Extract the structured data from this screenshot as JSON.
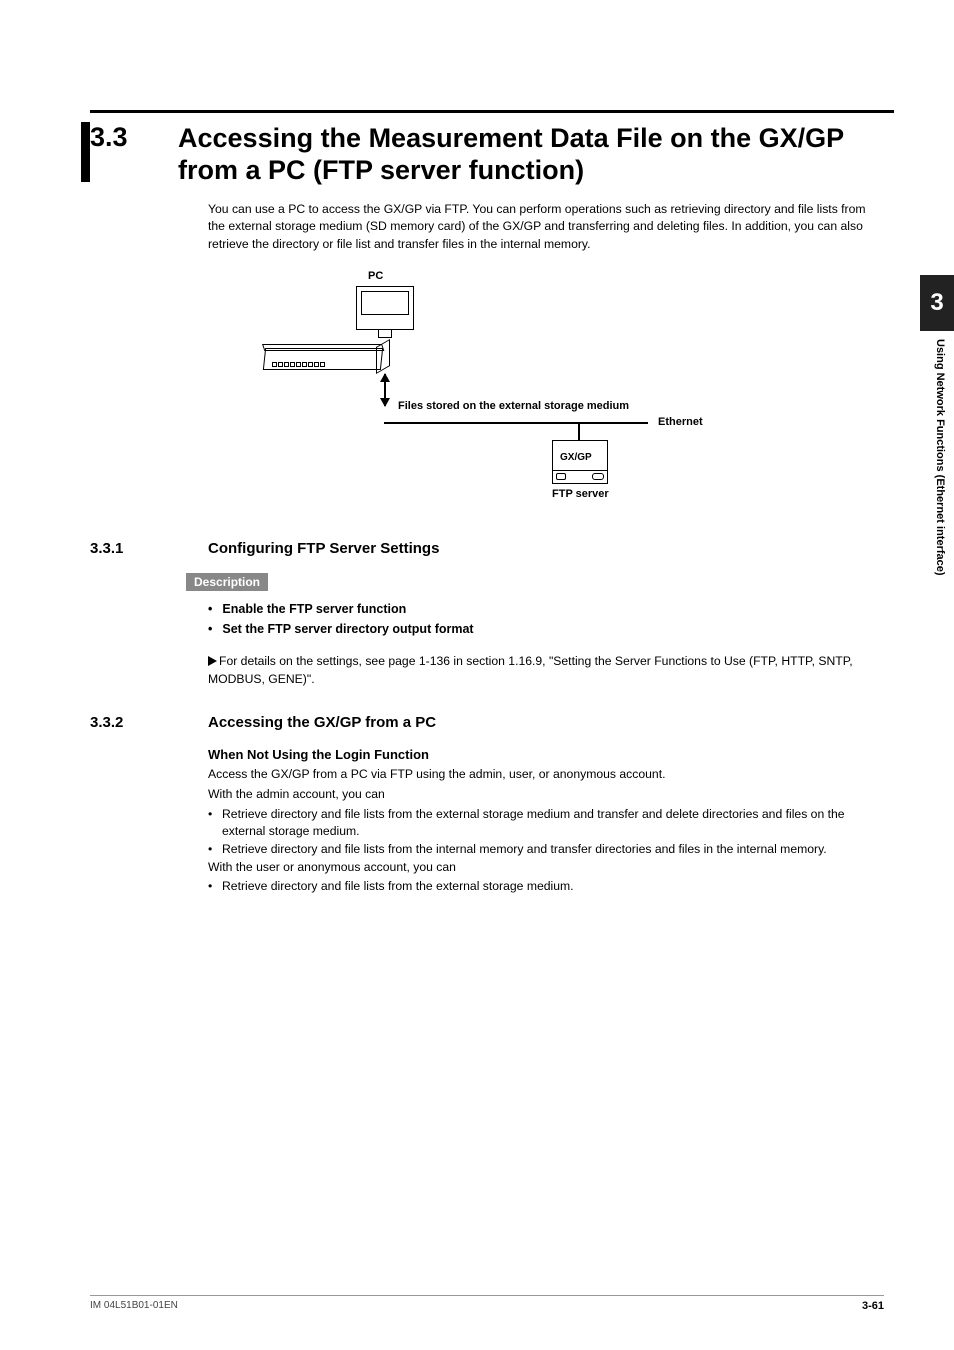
{
  "side": {
    "chapter": "3",
    "label": "Using Network Functions (Ethernet interface)"
  },
  "title": {
    "num": "3.3",
    "text": "Accessing the Measurement Data File on the GX/GP from a PC (FTP server function)"
  },
  "intro": "You can use a PC to access the GX/GP via FTP. You can perform operations such as retrieving directory and file lists from the external storage medium (SD memory card) of the GX/GP and transferring and deleting files. In addition, you can also retrieve the directory or file list and transfer files in the internal memory.",
  "diagram": {
    "pc": "PC",
    "files": "Files stored on the external storage medium",
    "ethernet": "Ethernet",
    "device": "GX/GP",
    "server": "FTP server"
  },
  "s331": {
    "num": "3.3.1",
    "title": "Configuring FTP Server Settings",
    "desc_label": "Description",
    "b1": "Enable the FTP server function",
    "b2": "Set the FTP server directory output format",
    "ref": "For details on the settings, see page 1-136 in section 1.16.9, \"Setting the Server Functions to Use (FTP, HTTP, SNTP, MODBUS, GENE)\"."
  },
  "s332": {
    "num": "3.3.2",
    "title": "Accessing the GX/GP from a PC",
    "h4": "When Not Using the Login Function",
    "p1": "Access the GX/GP from a PC via FTP using the admin, user, or anonymous account.",
    "p2": "With the admin account, you can",
    "li1": "Retrieve directory and file lists from the external storage medium and transfer and delete directories and files on the external storage medium.",
    "li2": "Retrieve directory and file lists from the internal memory and transfer directories and files in the internal memory.",
    "p3": "With the user or anonymous account, you can",
    "li3": "Retrieve directory and file lists from the external storage medium."
  },
  "footer": {
    "doc": "IM 04L51B01-01EN",
    "page": "3-61"
  }
}
